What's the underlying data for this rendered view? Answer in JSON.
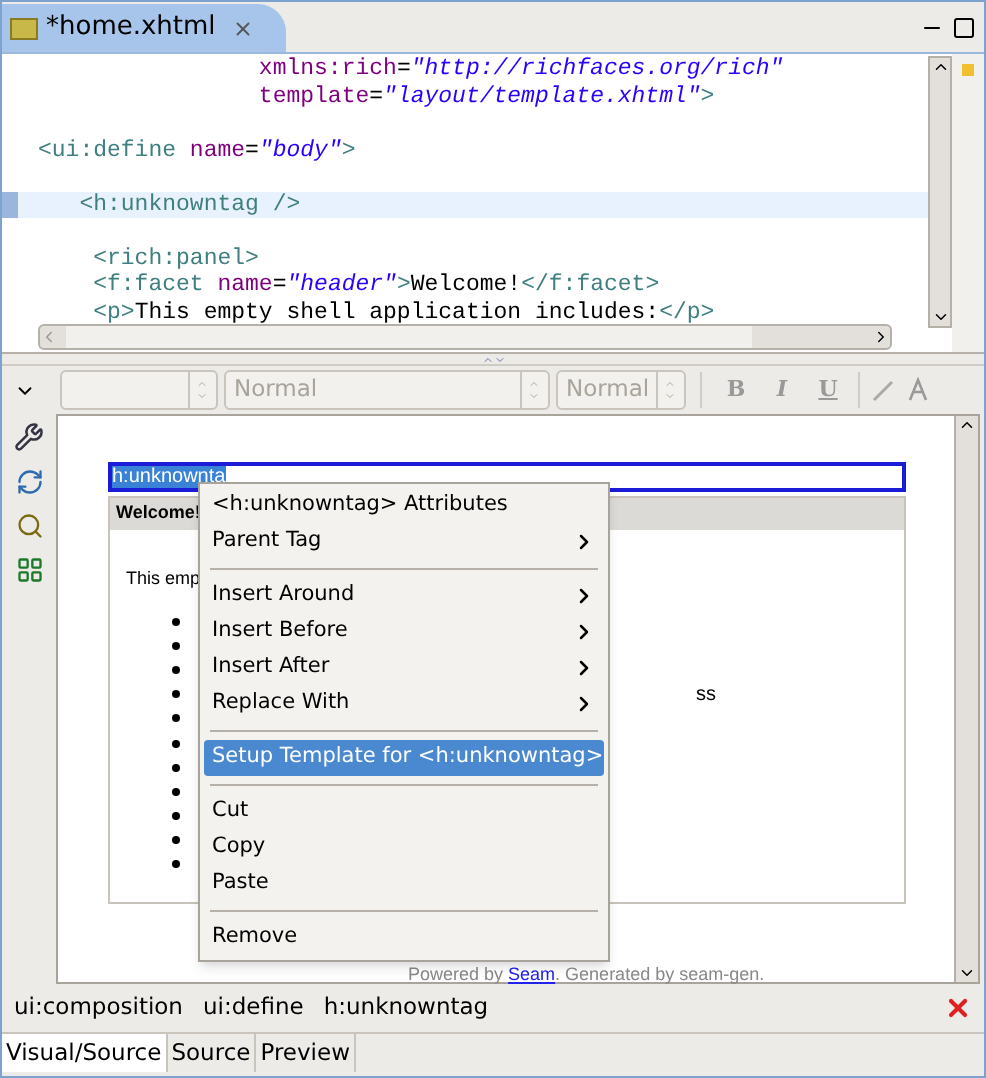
{
  "editor_tab": {
    "title": "*home.xhtml"
  },
  "code_lines": [
    {
      "current": false,
      "segments": [
        {
          "kind": "attr",
          "text": "                xmlns:rich"
        },
        {
          "kind": "text",
          "text": "="
        },
        {
          "kind": "value",
          "text": "\"http://richfaces.org/rich\""
        }
      ]
    },
    {
      "current": false,
      "segments": [
        {
          "kind": "attr",
          "text": "                template"
        },
        {
          "kind": "text",
          "text": "="
        },
        {
          "kind": "value",
          "text": "\"layout/template.xhtml\""
        },
        {
          "kind": "tag",
          "text": ">"
        }
      ]
    },
    {
      "current": false
    },
    {
      "current": false,
      "segments": [
        {
          "kind": "tag",
          "text": "<ui:define"
        },
        {
          "kind": "attr",
          "text": " name"
        },
        {
          "kind": "text",
          "text": "="
        },
        {
          "kind": "value",
          "text": "\"body\""
        },
        {
          "kind": "tag",
          "text": ">"
        }
      ]
    },
    {
      "current": false
    },
    {
      "current": true,
      "segments": [
        {
          "kind": "tag",
          "text": "   <h:unknowntag />"
        }
      ]
    },
    {
      "current": false
    },
    {
      "current": false,
      "segments": [
        {
          "kind": "tag",
          "text": "    <rich:panel>"
        }
      ]
    },
    {
      "current": false,
      "segments": [
        {
          "kind": "tag",
          "text": "    <f:facet"
        },
        {
          "kind": "attr",
          "text": " name"
        },
        {
          "kind": "text",
          "text": "="
        },
        {
          "kind": "value",
          "text": "\"header\""
        },
        {
          "kind": "tag",
          "text": ">"
        },
        {
          "kind": "text",
          "text": "Welcome!"
        },
        {
          "kind": "tag",
          "text": "</f:facet>"
        }
      ]
    },
    {
      "current": false,
      "segments": [
        {
          "kind": "tag",
          "text": "    <p>"
        },
        {
          "kind": "text",
          "text": "This empty shell application includes:"
        },
        {
          "kind": "tag",
          "text": "</p>"
        }
      ]
    }
  ],
  "format_toolbar": {
    "dropdowns": [
      {
        "kind": "blank"
      },
      {
        "kind": "text",
        "value": "Normal"
      },
      {
        "kind": "text",
        "value": "Normal"
      }
    ],
    "buttons": [
      "B",
      "I",
      "U"
    ]
  },
  "visual": {
    "selected_tag": "h:unknownta",
    "panel_header": "Welcome!",
    "intro": "This emp",
    "bullets": [
      {
        "kind": "dot"
      },
      {
        "kind": "dot"
      },
      {
        "kind": "dot"
      },
      {
        "kind": "dot"
      },
      {
        "kind": "dot"
      },
      {
        "kind": "dot"
      },
      {
        "kind": "dot"
      },
      {
        "kind": "dot"
      },
      {
        "kind": "dot"
      },
      {
        "kind": "dot"
      },
      {
        "kind": "dot"
      }
    ],
    "fragment": "ss",
    "footer_before": "Powered by ",
    "footer_link": "Seam",
    "footer_after": ". Generated by seam-gen."
  },
  "context_menu": [
    {
      "kind": "item",
      "label": "<h:unknowntag> Attributes",
      "submenu": false,
      "selected": false
    },
    {
      "kind": "item",
      "label": "Parent Tag",
      "submenu": true,
      "selected": false
    },
    {
      "kind": "separator"
    },
    {
      "kind": "item",
      "label": "Insert Around",
      "submenu": true,
      "selected": false
    },
    {
      "kind": "item",
      "label": "Insert Before",
      "submenu": true,
      "selected": false
    },
    {
      "kind": "item",
      "label": "Insert After",
      "submenu": true,
      "selected": false
    },
    {
      "kind": "item",
      "label": "Replace With",
      "submenu": true,
      "selected": false
    },
    {
      "kind": "separator"
    },
    {
      "kind": "item",
      "label": "Setup Template for <h:unknowntag>",
      "submenu": false,
      "selected": true
    },
    {
      "kind": "separator"
    },
    {
      "kind": "item",
      "label": "Cut",
      "submenu": false,
      "selected": false
    },
    {
      "kind": "item",
      "label": "Copy",
      "submenu": false,
      "selected": false
    },
    {
      "kind": "item",
      "label": "Paste",
      "submenu": false,
      "selected": false
    },
    {
      "kind": "separator"
    },
    {
      "kind": "item",
      "label": "Remove",
      "submenu": false,
      "selected": false
    }
  ],
  "breadcrumb": [
    "ui:composition",
    "ui:define",
    "h:unknowntag"
  ],
  "bottom_tabs": [
    {
      "label": "Visual/Source",
      "selected": true
    },
    {
      "label": "Source",
      "selected": false
    },
    {
      "label": "Preview",
      "selected": false
    }
  ]
}
